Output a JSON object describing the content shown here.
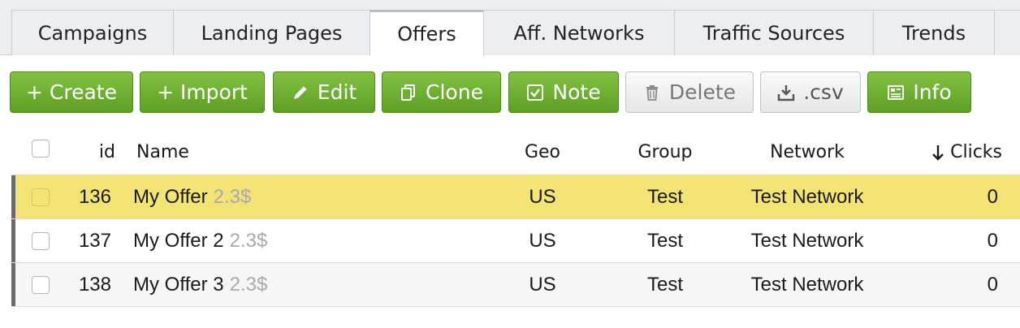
{
  "tabs": [
    {
      "label": "Campaigns",
      "active": false
    },
    {
      "label": "Landing Pages",
      "active": false
    },
    {
      "label": "Offers",
      "active": true
    },
    {
      "label": "Aff. Networks",
      "active": false
    },
    {
      "label": "Traffic Sources",
      "active": false
    },
    {
      "label": "Trends",
      "active": false
    }
  ],
  "toolbar": {
    "create": {
      "label": "+ Create",
      "icon": "none"
    },
    "import": {
      "label": "+ Import",
      "icon": "none"
    },
    "edit": {
      "label": "Edit",
      "icon": "pencil-icon"
    },
    "clone": {
      "label": "Clone",
      "icon": "copy-icon"
    },
    "note": {
      "label": "Note",
      "icon": "checkbox-note-icon"
    },
    "delete": {
      "label": "Delete",
      "icon": "trash-icon"
    },
    "csv": {
      "label": ".csv",
      "icon": "download-icon"
    },
    "info": {
      "label": "Info",
      "icon": "document-icon"
    }
  },
  "table": {
    "columns": {
      "id": "id",
      "name": "Name",
      "geo": "Geo",
      "group": "Group",
      "network": "Network",
      "clicks": "Clicks"
    },
    "sort_column": "clicks",
    "sort_direction": "desc",
    "rows": [
      {
        "id": "136",
        "name": "My Offer",
        "price": "2.3$",
        "geo": "US",
        "group": "Test",
        "network": "Test Network",
        "clicks": "0",
        "highlighted": true
      },
      {
        "id": "137",
        "name": "My Offer 2",
        "price": "2.3$",
        "geo": "US",
        "group": "Test",
        "network": "Test Network",
        "clicks": "0",
        "highlighted": false
      },
      {
        "id": "138",
        "name": "My Offer 3",
        "price": "2.3$",
        "geo": "US",
        "group": "Test",
        "network": "Test Network",
        "clicks": "0",
        "highlighted": false
      }
    ]
  },
  "colors": {
    "button_green": "#6fb033",
    "highlight_row": "#f3e375",
    "tab_bg": "#eceef1",
    "price_text": "#a9a9a9"
  }
}
